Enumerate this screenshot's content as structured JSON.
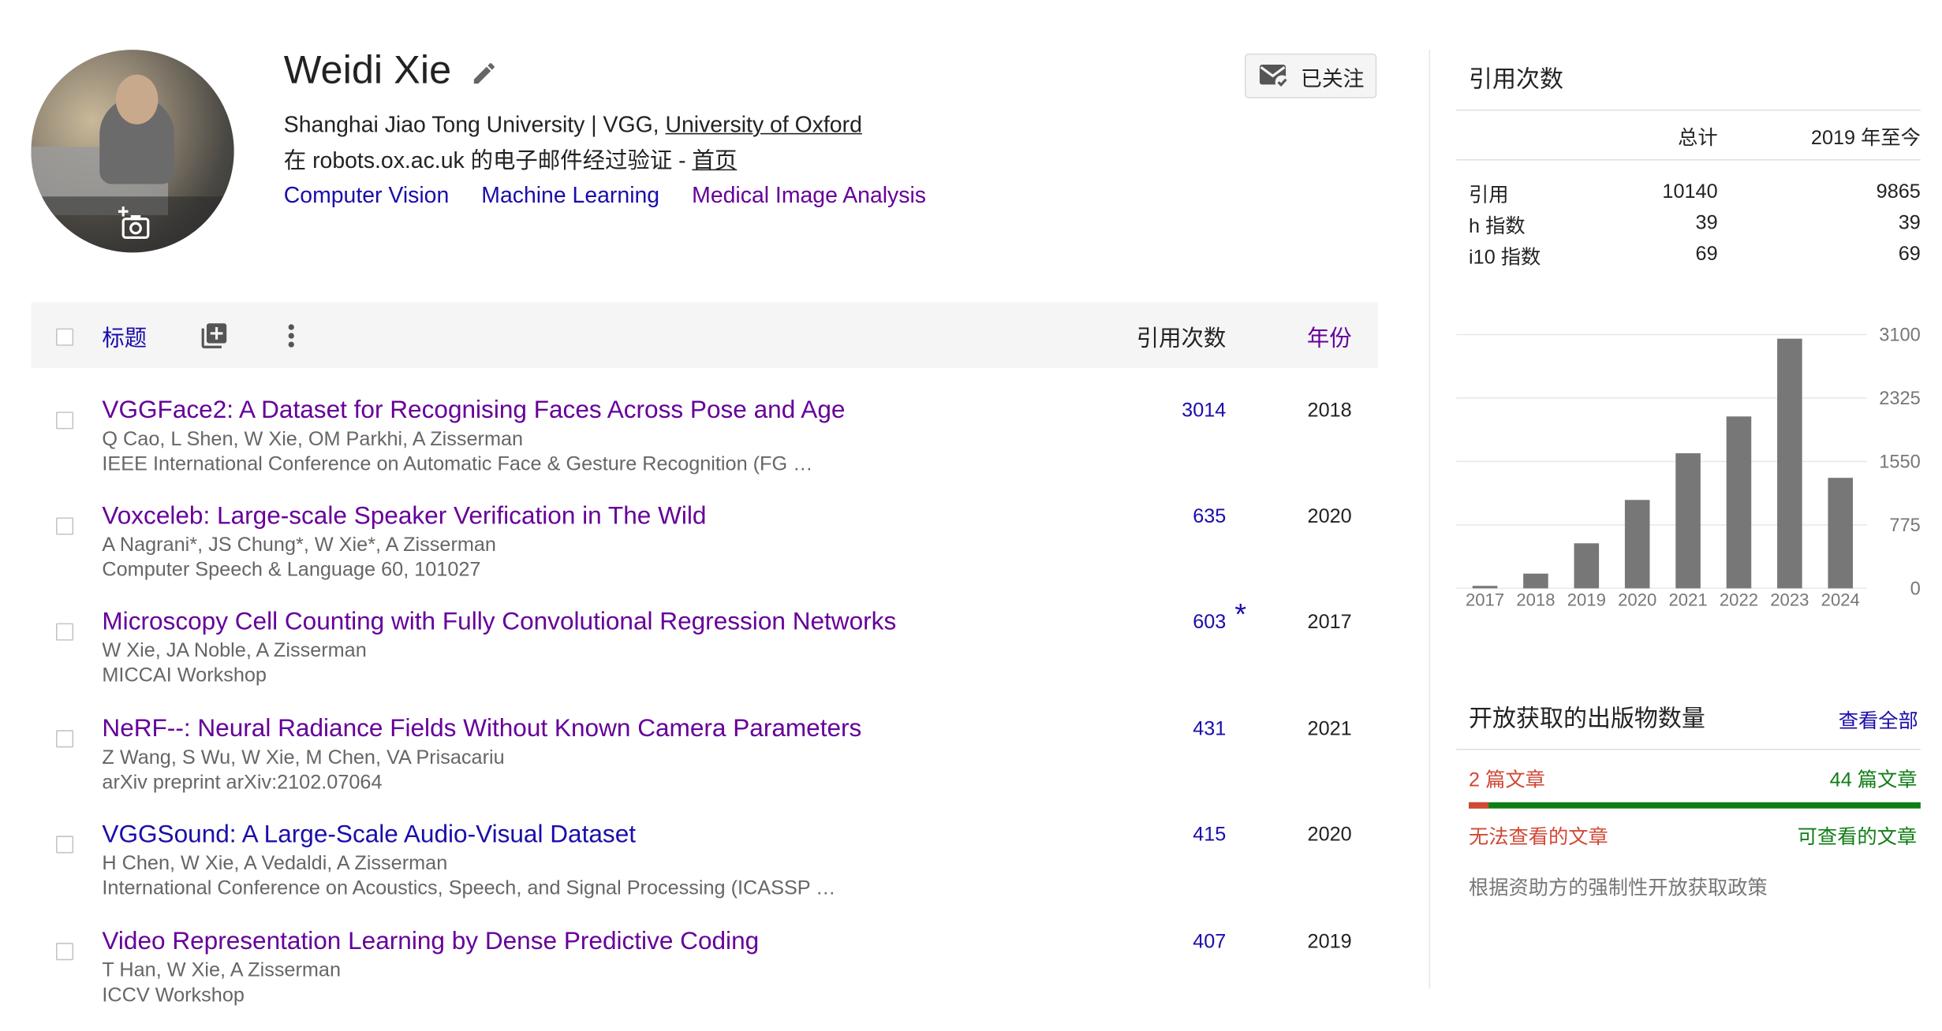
{
  "profile": {
    "name": "Weidi Xie",
    "affiliation_prefix": "Shanghai Jiao Tong University | VGG, ",
    "affiliation_link": "University of Oxford",
    "verified_text": "在 robots.ox.ac.uk 的电子邮件经过验证 - ",
    "homepage_link": "首页",
    "interests": [
      "Computer Vision",
      "Machine Learning",
      "Medical Image Analysis"
    ],
    "follow_label": "已关注"
  },
  "table": {
    "title_header": "标题",
    "cited_header": "引用次数",
    "year_header": "年份",
    "rows": [
      {
        "title": "VGGFace2: A Dataset for Recognising Faces Across Pose and Age",
        "authors": "Q Cao, L Shen, W Xie, OM Parkhi, A Zisserman",
        "venue": "IEEE International Conference on Automatic Face & Gesture Recognition (FG …",
        "cited": "3014",
        "year": "2018"
      },
      {
        "title": "Voxceleb: Large-scale Speaker Verification in The Wild",
        "authors": "A Nagrani*, JS Chung*, W Xie*, A Zisserman",
        "venue": "Computer Speech & Language 60, 101027",
        "cited": "635",
        "year": "2020"
      },
      {
        "title": "Microscopy Cell Counting with Fully Convolutional Regression Networks",
        "authors": "W Xie, JA Noble, A Zisserman",
        "venue": "MICCAI Workshop",
        "cited": "603",
        "year": "2017",
        "star": "*"
      },
      {
        "title": "NeRF--: Neural Radiance Fields Without Known Camera Parameters",
        "authors": "Z Wang, S Wu, W Xie, M Chen, VA Prisacariu",
        "venue": "arXiv preprint arXiv:2102.07064",
        "cited": "431",
        "year": "2021"
      },
      {
        "title": "VGGSound: A Large-Scale Audio-Visual Dataset",
        "authors": "H Chen, W Xie, A Vedaldi, A Zisserman",
        "venue": "International Conference on Acoustics, Speech, and Signal Processing (ICASSP …",
        "cited": "415",
        "year": "2020"
      },
      {
        "title": "Video Representation Learning by Dense Predictive Coding",
        "authors": "T Han, W Xie, A Zisserman",
        "venue": "ICCV Workshop",
        "cited": "407",
        "year": "2019"
      }
    ]
  },
  "citations": {
    "title": "引用次数",
    "col_total": "总计",
    "col_since": "2019 年至今",
    "rows": [
      {
        "label": "引用",
        "total": "10140",
        "since": "9865"
      },
      {
        "label": "h 指数",
        "total": "39",
        "since": "39"
      },
      {
        "label": "i10 指数",
        "total": "69",
        "since": "69"
      }
    ]
  },
  "chart_data": {
    "type": "bar",
    "categories": [
      "2017",
      "2018",
      "2019",
      "2020",
      "2021",
      "2022",
      "2023",
      "2024"
    ],
    "values": [
      30,
      180,
      550,
      1080,
      1650,
      2100,
      3050,
      1350
    ],
    "yticks": [
      "3100",
      "2325",
      "1550",
      "775",
      "0"
    ],
    "ylim": [
      0,
      3100
    ],
    "bar_color": "#777777"
  },
  "open_access": {
    "title": "开放获取的出版物数量",
    "view_all": "查看全部",
    "unavailable_count": "2 篇文章",
    "available_count": "44 篇文章",
    "unavailable_label": "无法查看的文章",
    "available_label": "可查看的文章",
    "unavailable_fraction": 0.043,
    "policy_text": "根据资助方的强制性开放获取政策"
  }
}
